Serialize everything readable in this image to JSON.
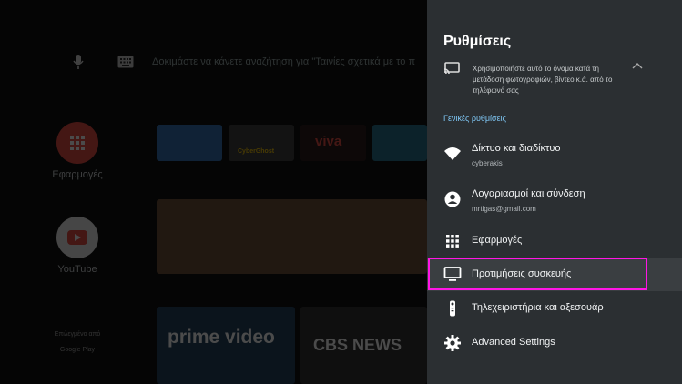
{
  "home": {
    "search_hint": "Δοκιμάστε να κάνετε αναζήτηση για \"Ταινίες σχετικά με το π",
    "apps": [
      {
        "label": "Εφαρμογές"
      },
      {
        "label": "YouTube"
      }
    ],
    "featured_label": "Επιλεγμένο από",
    "featured_source": "Google Play",
    "tiles": {
      "cyberghost": "CyberGhost",
      "viva": "viva",
      "prime": "prime video",
      "cbs": "CBS NEWS"
    }
  },
  "settings": {
    "title": "Ρυθμίσεις",
    "cast_description": "Χρησιμοποιήστε αυτό το όνομα κατά τη μετάδοση φωτογραφιών, βίντεο κ.ά. από το τηλέφωνό σας",
    "section_general": "Γενικές ρυθμίσεις",
    "items": [
      {
        "label": "Δίκτυο και διαδίκτυο",
        "sub": "cyberakis",
        "icon": "wifi-icon"
      },
      {
        "label": "Λογαριασμοί και σύνδεση",
        "sub": "mrtigas@gmail.com",
        "icon": "account-icon"
      },
      {
        "label": "Εφαρμογές",
        "icon": "apps-grid-icon"
      },
      {
        "label": "Προτιμήσεις συσκευής",
        "icon": "tv-monitor-icon"
      },
      {
        "label": "Τηλεχειριστήρια και αξεσουάρ",
        "icon": "remote-icon"
      },
      {
        "label": "Advanced Settings",
        "icon": "gear-icon"
      }
    ]
  },
  "colors": {
    "panel_bg": "#2b2f32",
    "section_accent": "#7fc7f5",
    "highlight": "#ff16e4"
  }
}
